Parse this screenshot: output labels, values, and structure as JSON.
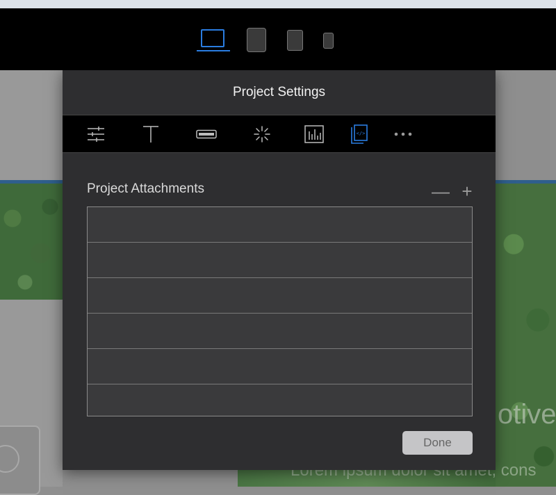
{
  "device_toolbar": {
    "devices": [
      {
        "name": "laptop-icon",
        "selected": true
      },
      {
        "name": "tablet-landscape-icon",
        "selected": false
      },
      {
        "name": "tablet-icon",
        "selected": false
      },
      {
        "name": "phone-icon",
        "selected": false
      }
    ],
    "accent_color": "#2a7de1"
  },
  "background": {
    "headline_fragment": "otive",
    "body_fragment": "Lorem ipsum dolor sit amet, cons"
  },
  "dialog": {
    "title": "Project Settings",
    "tabs": [
      {
        "icon": "sliders-icon",
        "selected": false
      },
      {
        "icon": "text-icon",
        "selected": false
      },
      {
        "icon": "button-icon",
        "selected": false
      },
      {
        "icon": "spinner-icon",
        "selected": false
      },
      {
        "icon": "chart-icon",
        "selected": false
      },
      {
        "icon": "code-file-icon",
        "selected": true
      },
      {
        "icon": "more-icon",
        "selected": false
      }
    ],
    "section_title": "Project Attachments",
    "remove_label": "—",
    "add_label": "+",
    "attachments": [
      "",
      "",
      "",
      "",
      "",
      ""
    ],
    "done_label": "Done"
  }
}
